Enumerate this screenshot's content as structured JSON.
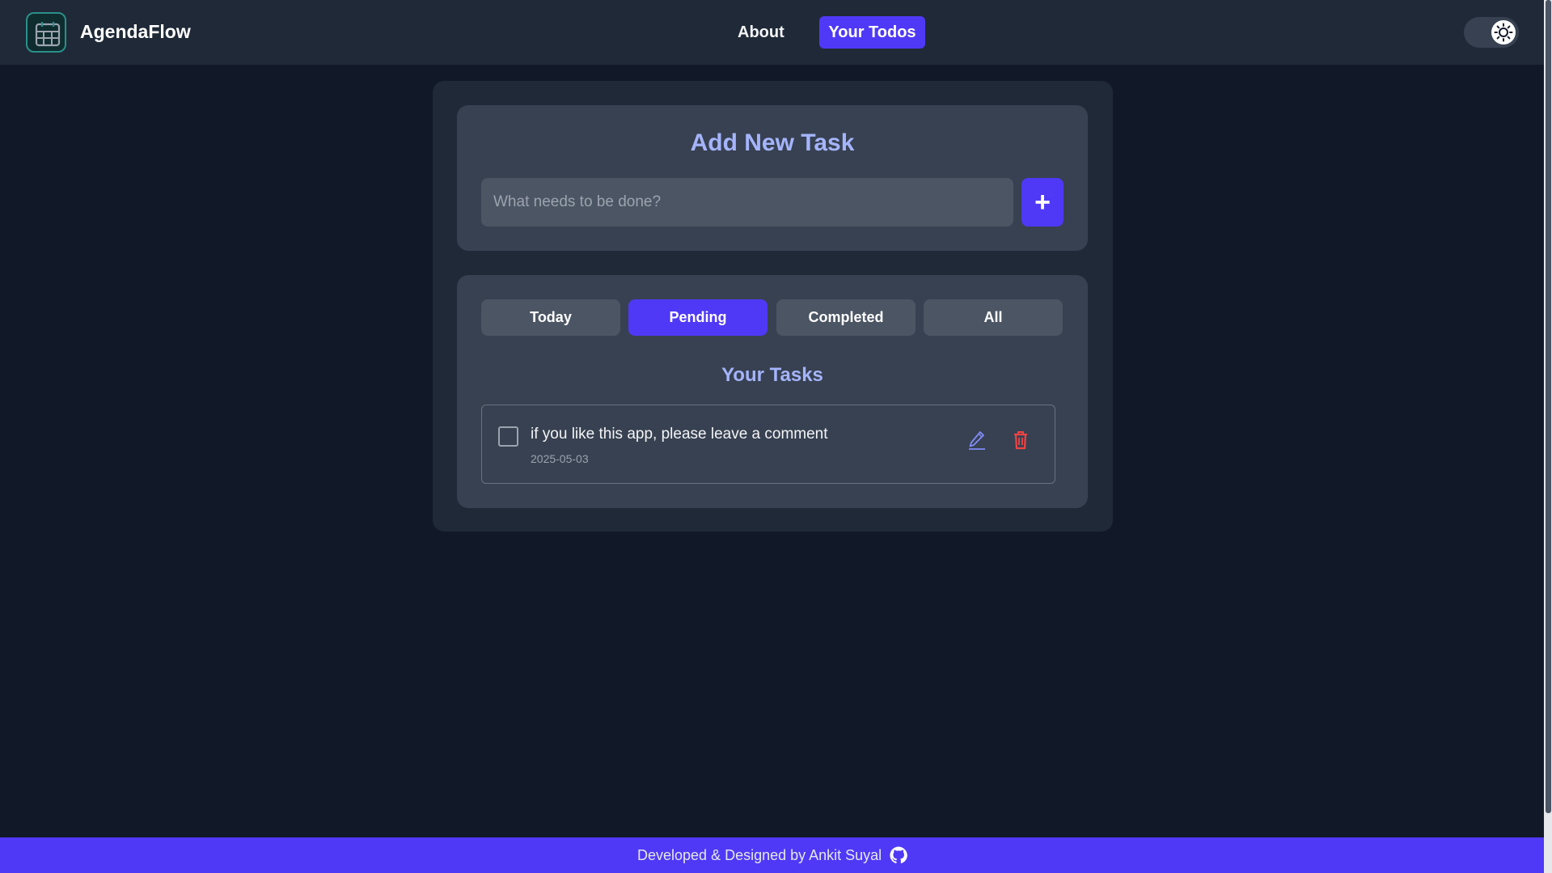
{
  "app": {
    "brand": "AgendaFlow"
  },
  "nav": {
    "about": "About",
    "todos": "Your Todos"
  },
  "add_task": {
    "title": "Add New Task",
    "placeholder": "What needs to be done?",
    "button_label": "+"
  },
  "filters": {
    "today": "Today",
    "pending": "Pending",
    "completed": "Completed",
    "all": "All",
    "active": "Pending"
  },
  "tasks": {
    "title": "Your Tasks",
    "items": [
      {
        "text": "if you like this app, please leave a comment",
        "date": "2025-05-03",
        "completed": false
      }
    ]
  },
  "footer": {
    "text": "Developed & Designed by Ankit Suyal"
  },
  "icons": {
    "logo": "calendar-grid-icon",
    "theme": "sun-icon",
    "edit": "pencil-icon",
    "delete": "trash-icon",
    "github": "github-icon"
  },
  "colors": {
    "accent": "#4f39f6",
    "heading": "#a5b4fc",
    "delete": "#ef4444",
    "edit": "#818cf8"
  }
}
